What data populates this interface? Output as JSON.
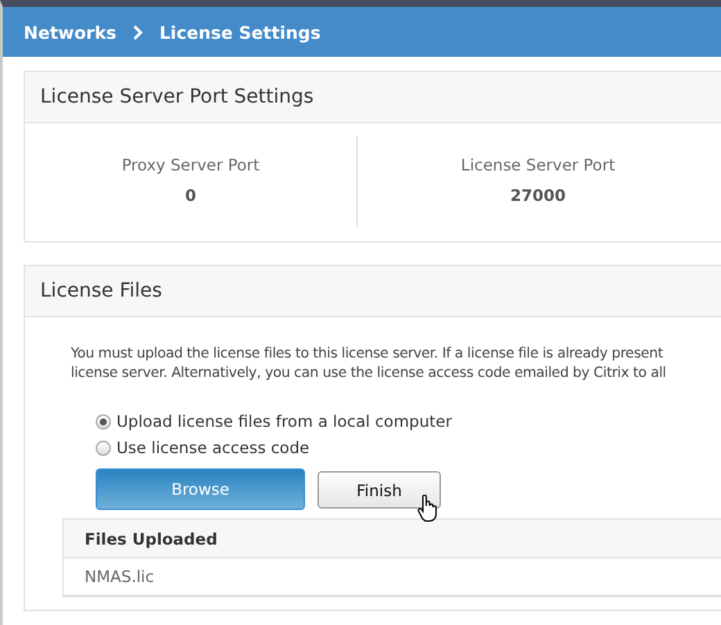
{
  "breadcrumb": [
    "Networks",
    "License Settings"
  ],
  "port_settings": {
    "title": "License Server Port Settings",
    "ports": [
      {
        "label": "Proxy Server Port",
        "value": "0"
      },
      {
        "label": "License Server Port",
        "value": "27000"
      }
    ]
  },
  "license_files": {
    "title": "License Files",
    "description": [
      "You must upload the license files to this license server. If a license file is already present",
      "license server. Alternatively, you can use the license access code emailed by Citrix to all"
    ],
    "options": [
      {
        "label": "Upload license files from a local computer",
        "selected": true
      },
      {
        "label": "Use license access code",
        "selected": false
      }
    ],
    "buttons": [
      {
        "label": "Browse",
        "kind": "primary"
      },
      {
        "label": "Finish",
        "kind": "secondary"
      }
    ],
    "files_table": {
      "column": "Files Uploaded",
      "rows": [
        "NMAS.lic"
      ]
    }
  }
}
